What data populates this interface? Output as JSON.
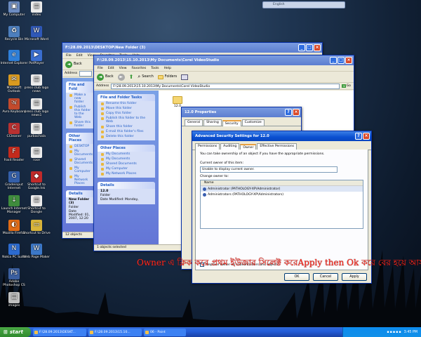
{
  "desktop_icons": [
    {
      "label": "My Computer",
      "color": "#6c8cc2",
      "glyph": "▣"
    },
    {
      "label": "Recycle Bin",
      "color": "#4d7fbe",
      "glyph": "♻"
    },
    {
      "label": "Internet Explorer",
      "color": "#2f7fd8",
      "glyph": "e"
    },
    {
      "label": "Microsoft Outlook",
      "color": "#d99a1f",
      "glyph": "✉"
    },
    {
      "label": "Avro Keyboard",
      "color": "#c34a2c",
      "glyph": "অ"
    },
    {
      "label": "CCleaner",
      "color": "#b93131",
      "glyph": "C"
    },
    {
      "label": "Foxit Reader",
      "color": "#c42a1c",
      "glyph": "F"
    },
    {
      "label": "Gradeinput Internet",
      "color": "#345fa9",
      "glyph": "G"
    },
    {
      "label": "Launch Internet Manager",
      "color": "#3f8c3d",
      "glyph": "↓"
    },
    {
      "label": "Mozilla Firefox",
      "color": "#e06b16",
      "glyph": "◐"
    },
    {
      "label": "Nokia PC Suite",
      "color": "#2c6bd0",
      "glyph": "N"
    },
    {
      "label": "Adobe Photoshop CS",
      "color": "#3b5fa0",
      "glyph": "Ps"
    },
    {
      "label": "images",
      "color": "#c0c0c0",
      "glyph": "▤"
    }
  ],
  "desktop_icons_col2": [
    {
      "label": "index",
      "color": "#ececec",
      "glyph": "▤"
    },
    {
      "label": "Microsoft Word",
      "color": "#2f58b8",
      "glyph": "W"
    },
    {
      "label": "PotPlayer",
      "color": "#3a6ed0",
      "glyph": "▶"
    },
    {
      "label": "press club logo news",
      "color": "#ececec",
      "glyph": "▤"
    },
    {
      "label": "press club logo news1",
      "color": "#ececec",
      "glyph": "▤"
    },
    {
      "label": "purbachala",
      "color": "#ececec",
      "glyph": "▤"
    },
    {
      "label": "rose",
      "color": "#ececec",
      "glyph": "▤"
    },
    {
      "label": "Shortcut to Google.lnk",
      "color": "#c12a2a",
      "glyph": "◆"
    },
    {
      "label": "Shortcut to Dongle",
      "color": "#ececec",
      "glyph": "▤"
    },
    {
      "label": "Shortcut to Drive",
      "color": "#d8b43a",
      "glyph": "▭"
    },
    {
      "label": "Web Page Maker",
      "color": "#3c78c8",
      "glyph": "W"
    }
  ],
  "win1": {
    "title": "F:\\28.09.2013\\DESKTOP\\New Folder (3)",
    "menus": [
      "File",
      "Edit",
      "View",
      "Favorites",
      "Tools",
      "Help"
    ],
    "back": "Back",
    "address_label": "Address",
    "tasks_header": "File and Fold",
    "tasks": [
      "Make a new folder",
      "Publish this folder to the Web",
      "Share this folder"
    ],
    "other_header": "Other Places",
    "other": [
      "DESKTOP",
      "My Documents",
      "Shared Documents",
      "My Computer",
      "My Network Places"
    ],
    "details_header": "Details",
    "details_name": "New Folder (3)",
    "details_type": "Folder",
    "details_date": "Date Modified: 01, 2007, 12:20",
    "status": "12 objects"
  },
  "win2": {
    "title": "F:\\28.09.2013\\15.10.2013\\My Documents\\Corel VideoStudio",
    "menus": [
      "File",
      "Edit",
      "View",
      "Favorites",
      "Tools",
      "Help"
    ],
    "back": "Back",
    "search": "Search",
    "folders": "Folders",
    "address_label": "Address",
    "address": "F:\\28.09.2013\\15.10.2013\\My Documents\\Corel VideoStudio",
    "go": "Go",
    "tasks_header": "File and Folder Tasks",
    "tasks": [
      "Rename this folder",
      "Move this folder",
      "Copy this folder",
      "Publish this folder to the Web",
      "Share this folder",
      "E-mail this folder's files",
      "Delete this folder"
    ],
    "other_header": "Other Places",
    "other": [
      "My Documents",
      "My Documents",
      "Shared Documents",
      "My Computer",
      "My Network Places"
    ],
    "details_header": "Details",
    "details_name": "12.0",
    "details_type": "Folder",
    "details_date": "Date Modified: Monday,",
    "folder_label": "12.0",
    "status": "1 objects selected"
  },
  "props": {
    "title": "12.0 Properties",
    "tabs": [
      "General",
      "Sharing",
      "Security",
      "Customize"
    ],
    "active_tab": 2
  },
  "adv": {
    "title": "Advanced Security Settings for 12.0",
    "tabs": [
      "Permissions",
      "Auditing",
      "Owner",
      "Effective Permissions"
    ],
    "intro": "You can take ownership of an object if you have the appropriate permissions.",
    "current_label": "Current owner of this item:",
    "current_value": "Unable to display current owner.",
    "change_label": "Change owner to:",
    "col_name": "Name",
    "owners": [
      "Administrator (PATHOLOGY-XP\\Administrator)",
      "Administrators (PATHOLOGY-XP\\Administrators)"
    ],
    "replace_label": "Replace owner on subcontainers and objects",
    "ok": "OK",
    "cancel": "Cancel",
    "apply": "Apply"
  },
  "caption": "Owner এ ক্লিক করে প্রথম ইউজার সিলেক্ট করেApply then Ok করে বের হয়ে আসুন",
  "lang_bar": "English",
  "taskbar": {
    "start": "start",
    "tasks": [
      "F:\\28.09.2013\\DESKT...",
      "F:\\28.09.2013\\15.10...",
      "06 - Paint"
    ],
    "clock": "3:45 PM"
  }
}
